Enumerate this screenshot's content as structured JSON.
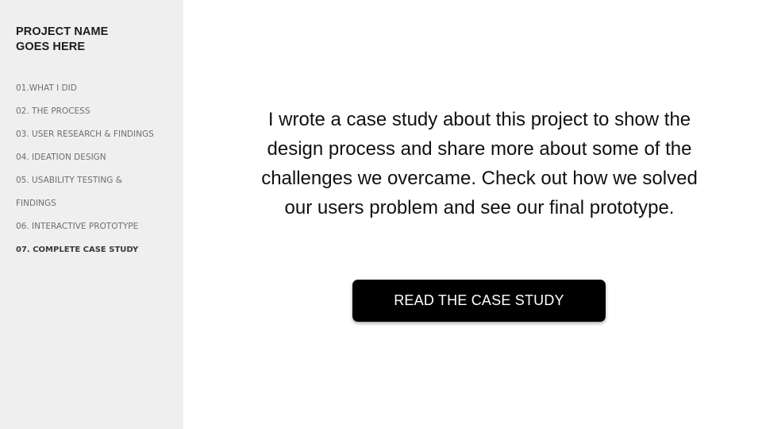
{
  "sidebar": {
    "project_title": "PROJECT NAME GOES HERE",
    "items": [
      {
        "label": "01.WHAT I DID"
      },
      {
        "label": "02. THE PROCESS"
      },
      {
        "label": "03. USER RESEARCH & FINDINGS"
      },
      {
        "label": "04. IDEATION DESIGN"
      },
      {
        "label": "05. USABILITY TESTING &"
      },
      {
        "label": "FINDINGS"
      },
      {
        "label": "06. INTERACTIVE PROTOTYPE"
      },
      {
        "label": "07. COMPLETE CASE STUDY",
        "active": true
      }
    ]
  },
  "main": {
    "description": "I wrote a case study about this project to show the design process and share more about some of the challenges we overcame. Check out how we solved our users problem and see our final prototype.",
    "cta_label": "READ THE CASE STUDY"
  },
  "colors": {
    "sidebar_bg": "#efefef",
    "button_bg": "#000000",
    "button_text": "#ffffff"
  }
}
